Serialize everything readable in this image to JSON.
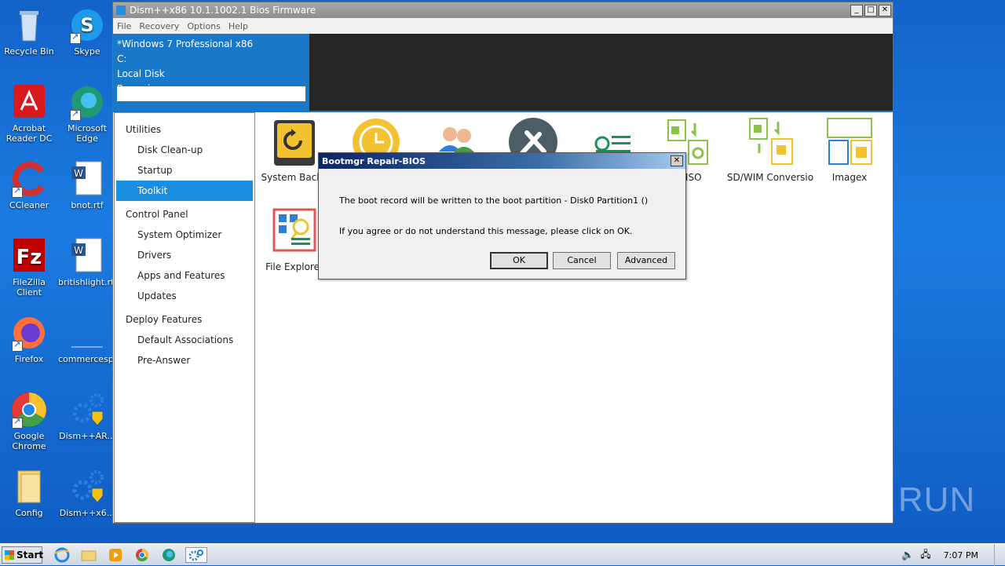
{
  "desktop": {
    "icons": [
      {
        "label": "Recycle Bin"
      },
      {
        "label": "Skype"
      },
      {
        "label": "Acrobat Reader DC"
      },
      {
        "label": "Microsoft Edge"
      },
      {
        "label": "CCleaner"
      },
      {
        "label": "bnot.rtf"
      },
      {
        "label": "FileZilla Client"
      },
      {
        "label": "britishlight.rtf"
      },
      {
        "label": "Firefox"
      },
      {
        "label": "commercesp..."
      },
      {
        "label": "Google Chrome"
      },
      {
        "label": "Dism++AR..."
      },
      {
        "label": "Config"
      },
      {
        "label": "Dism++x6..."
      }
    ]
  },
  "window": {
    "title": "Dism++x86 10.1.1002.1 Bios Firmware",
    "menu": [
      "File",
      "Recovery",
      "Options",
      "Help"
    ],
    "session": {
      "os": "*Windows 7 Professional x86",
      "drive": "C:",
      "disk": "Local Disk",
      "status": "Preparing"
    },
    "sidebar": {
      "groups": [
        {
          "label": "Utilities",
          "items": [
            "Disk Clean-up",
            "Startup",
            "Toolkit"
          ]
        },
        {
          "label": "Control Panel",
          "items": [
            "System Optimizer",
            "Drivers",
            "Apps and Features",
            "Updates"
          ]
        },
        {
          "label": "Deploy Features",
          "items": [
            "Default Associations",
            "Pre-Answer"
          ]
        }
      ],
      "selected": "Toolkit"
    },
    "tools": [
      {
        "label": "System Backu",
        "icon": "backup-drive-icon"
      },
      {
        "label": "",
        "icon": "clock-restore-icon"
      },
      {
        "label": "",
        "icon": "users-icon"
      },
      {
        "label": "",
        "icon": "wrench-tools-icon"
      },
      {
        "label": "",
        "icon": "list-settings-icon"
      },
      {
        "label": "To ISO",
        "icon": "to-iso-icon"
      },
      {
        "label": "SD/WIM Conversio",
        "icon": "wim-conversion-icon"
      },
      {
        "label": "Imagex",
        "icon": "imagex-icon"
      },
      {
        "label": "File Explorer",
        "icon": "file-explorer-icon"
      }
    ]
  },
  "dialog": {
    "title": "Bootmgr Repair-BIOS",
    "message1": "The boot record will be written to the boot partition - Disk0 Partition1 ()",
    "message2": "If you agree or do not understand this message, please click on OK.",
    "buttons": {
      "ok": "OK",
      "cancel": "Cancel",
      "advanced": "Advanced"
    }
  },
  "taskbar": {
    "start": "Start",
    "clock": "7:07 PM"
  },
  "watermark": "ANY RUN",
  "colors": {
    "accent": "#1a78c9",
    "desktop": "#1b7be0",
    "selected": "#1a8ee0"
  }
}
